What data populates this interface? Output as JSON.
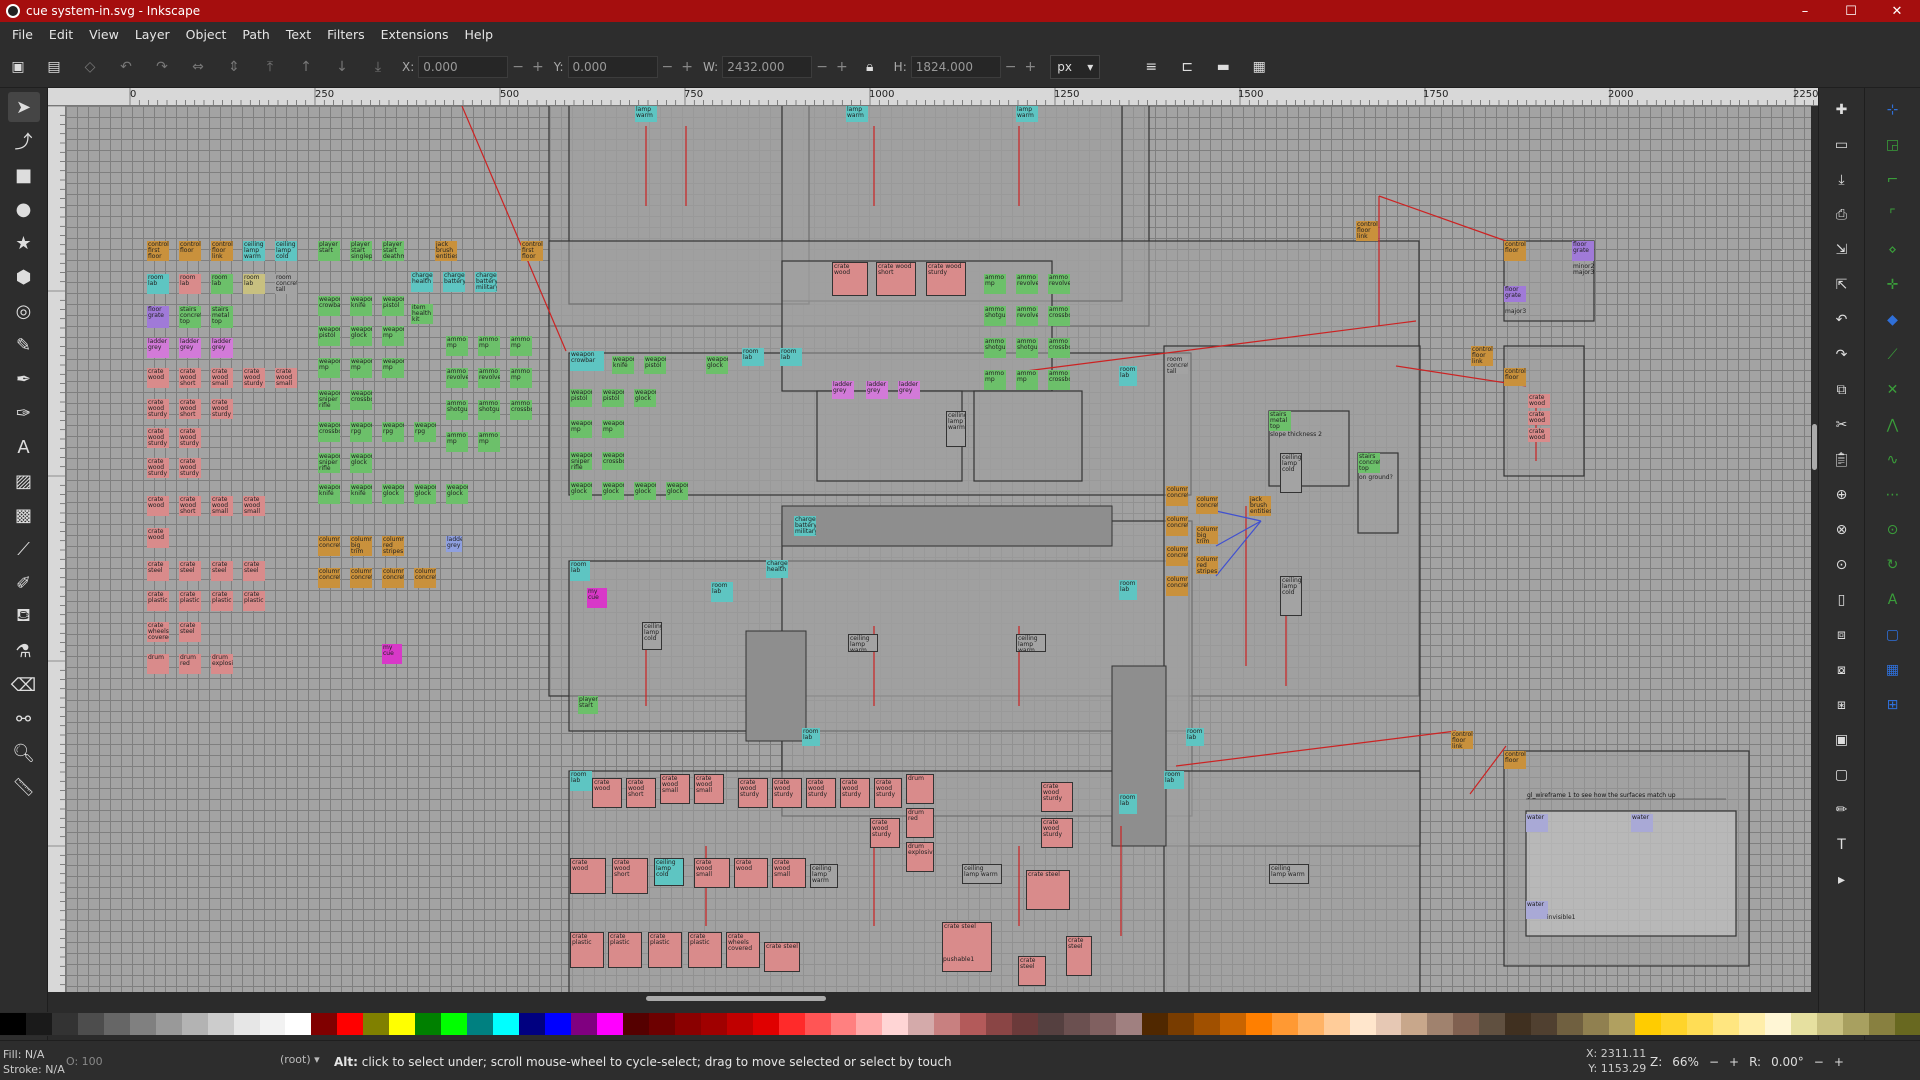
{
  "window": {
    "title": "cue system-in.svg - Inkscape",
    "controls": [
      "–",
      "☐",
      "✕"
    ]
  },
  "menu": [
    "File",
    "Edit",
    "View",
    "Layer",
    "Object",
    "Path",
    "Text",
    "Filters",
    "Extensions",
    "Help"
  ],
  "toolbar": {
    "x_label": "X:",
    "x_value": "0.000",
    "y_label": "Y:",
    "y_value": "0.000",
    "w_label": "W:",
    "w_value": "2432.000",
    "h_label": "H:",
    "h_value": "1824.000",
    "unit": "px"
  },
  "ruler_top_labels": [
    "0",
    "250",
    "500",
    "750",
    "1000",
    "1250",
    "1500",
    "1750",
    "2000",
    "2250"
  ],
  "ruler_left_labels": [
    "0",
    "250",
    "500",
    "750",
    "1000",
    "1250",
    "1500"
  ],
  "canvas": {
    "labels": {
      "control_first_floor": "control first floor",
      "control_floor": "control floor",
      "control_floor_link": "control floor link",
      "ceiling_lamp_warm": "ceiling lamp warm",
      "ceiling_lamp_cold": "ceiling lamp cold",
      "player_start": "player start",
      "player_start_singleplayer": "player start singleplayer",
      "player_start_deathmatch": "player start deathmatch",
      "jack_brush_entities": "jack brush entities",
      "room_lab": "room lab",
      "room_concrete_tall": "room concrete tall",
      "charger_health": "charger health",
      "charger_battery": "charger battery",
      "charger_battery_military": "charger battery military",
      "floor_grate": "floor grate",
      "stairs_concrete_top": "stairs concrete top",
      "stairs_metal_top": "stairs metal top",
      "item_health_kit": "item health kit",
      "ladder_grey": "ladder grey",
      "crate_wood": "crate wood",
      "crate_wood_short": "crate wood short",
      "crate_wood_small": "crate wood small",
      "crate_wood_sturdy": "crate wood sturdy",
      "crate_steel": "crate steel",
      "crate_plastic": "crate plastic",
      "crate_wheels": "crate wheels covered",
      "drum": "drum",
      "drum_red": "drum red",
      "drum_explosive": "drum explosive",
      "weapon_crowbar": "weapon crowbar",
      "weapon_knife": "weapon knife",
      "weapon_pistol": "weapon pistol",
      "weapon_mp": "weapon mp",
      "weapon_sniper": "weapon sniper rifle",
      "weapon_crossbow": "weapon crossbow",
      "weapon_rpg": "weapon rpg",
      "weapon_glock": "weapon glock",
      "ammo_mp": "ammo mp",
      "ammo_shotgun": "ammo shotgun",
      "ammo_revolver": "ammo revolver",
      "ammo_crossbow": "ammo crossbow",
      "column_concrete": "column concrete",
      "column_big_trim": "column big trim",
      "column_red_stripes": "column red stripes",
      "my_cue": "my cue",
      "slope_thickness": "slope thickness 2",
      "on_ground": "on ground?",
      "major3": "major3",
      "minor2_major3": "minor2 major3",
      "invisible1": "invisible1",
      "water": "water",
      "gl_wireframe_note": "gl_wireframe 1 to see how the surfaces match up",
      "pushable": "pushable1",
      "lamp_warm": "lamp warm"
    }
  },
  "status": {
    "fill_label": "Fill:",
    "fill_value": "N/A",
    "stroke_label": "Stroke:",
    "stroke_value": "N/A",
    "opacity_label": "O:",
    "opacity_value": "100",
    "layer": "(root)",
    "message_bold": "Alt:",
    "message": " click to select under; scroll mouse-wheel to cycle-select; drag to move selected or select by touch",
    "x_label": "X:",
    "x_value": "2311.11",
    "y_label": "Y:",
    "y_value": "1153.29",
    "zoom_label": "Z:",
    "zoom_value": "66%",
    "rotation_label": "R:",
    "rotation_value": "0.00°"
  },
  "colors": {
    "titlebar": "#a50e0e",
    "tile_orange": "#c9913c",
    "tile_teal": "#5ec5c2",
    "tile_green": "#6cc06a",
    "tile_red": "#d98b8b",
    "tile_magenta": "#d838c8",
    "tile_purple": "#a07ad8",
    "guide_line": "#cc2222",
    "link_line": "#4050d0"
  },
  "palette": [
    "#000000",
    "#1a1a1a",
    "#333333",
    "#4d4d4d",
    "#666666",
    "#808080",
    "#999999",
    "#b3b3b3",
    "#cccccc",
    "#e6e6e6",
    "#f2f2f2",
    "#ffffff",
    "#800000",
    "#ff0000",
    "#808000",
    "#ffff00",
    "#008000",
    "#00ff00",
    "#008080",
    "#00ffff",
    "#000080",
    "#0000ff",
    "#800080",
    "#ff00ff",
    "#550000",
    "#6d0000",
    "#8a0000",
    "#a00000",
    "#c00000",
    "#e00000",
    "#ff2a2a",
    "#ff5555",
    "#ff8080",
    "#ffaaaa",
    "#ffd5d5",
    "#d4aaaa",
    "#c88080",
    "#b35a5a",
    "#8a4545",
    "#6b3a3a",
    "#554040",
    "#6b5050",
    "#806060",
    "#a08080",
    "#502800",
    "#783c00",
    "#a05000",
    "#c86400",
    "#ff7f00",
    "#ff9933",
    "#ffb366",
    "#ffcc99",
    "#ffe6cc",
    "#e6c8b4",
    "#c8a78b",
    "#a0826e",
    "#806050",
    "#605040",
    "#403020",
    "#504030",
    "#706040",
    "#908050",
    "#b0a060",
    "#ffcc00",
    "#ffd42a",
    "#ffdd55",
    "#ffe680",
    "#ffeeaa",
    "#fff6d5",
    "#e6e0a0",
    "#c8c080",
    "#a8a060",
    "#888040",
    "#686820"
  ]
}
